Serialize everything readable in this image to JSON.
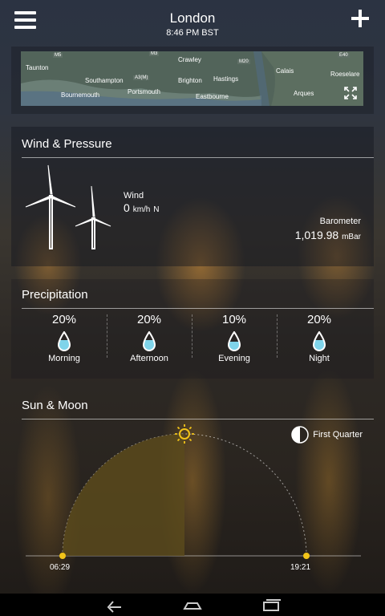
{
  "header": {
    "city": "London",
    "time": "8:46 PM BST",
    "menu_icon": "hamburger-menu-icon",
    "add_icon": "plus-icon"
  },
  "map": {
    "labels": [
      "Taunton",
      "Southampton",
      "Portsmouth",
      "Bournemouth",
      "Crawley",
      "Brighton",
      "Hastings",
      "Eastbourne",
      "Calais",
      "Roeselare",
      "Arques"
    ],
    "roads": [
      "M5",
      "M3",
      "A3(M)",
      "M20",
      "A29",
      "E40"
    ],
    "expand_icon": "expand-icon"
  },
  "wind_pressure": {
    "title": "Wind & Pressure",
    "wind_label": "Wind",
    "wind_speed": "0",
    "wind_unit": "km/h",
    "wind_dir": "N",
    "barometer_label": "Barometer",
    "barometer_value": "1,019.98",
    "barometer_unit": "mBar"
  },
  "precipitation": {
    "title": "Precipitation",
    "periods": [
      {
        "label": "Morning",
        "pct": "20%",
        "fill": 0.2
      },
      {
        "label": "Afternoon",
        "pct": "20%",
        "fill": 0.2
      },
      {
        "label": "Evening",
        "pct": "10%",
        "fill": 0.1
      },
      {
        "label": "Night",
        "pct": "20%",
        "fill": 0.2
      }
    ]
  },
  "sun_moon": {
    "title": "Sun & Moon",
    "moon_phase": "First Quarter",
    "sunrise": "06:29",
    "sunset": "19:21",
    "day_progress": 0.5
  },
  "navbar": {
    "back_icon": "back-icon",
    "home_icon": "home-icon",
    "recents_icon": "recents-icon"
  },
  "colors": {
    "accent_yellow": "#f2c419",
    "daylight_fill": "#5a4a1c"
  }
}
